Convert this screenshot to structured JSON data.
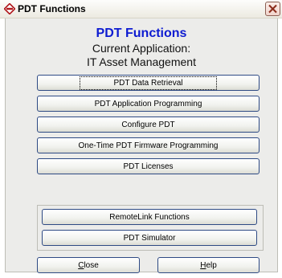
{
  "window": {
    "title": "PDT Functions"
  },
  "header": {
    "title": "PDT Functions",
    "subtitle_line1": "Current Application:",
    "subtitle_line2": "IT Asset Management"
  },
  "buttons": {
    "data_retrieval": "PDT Data Retrieval",
    "app_programming": "PDT Application Programming",
    "configure": "Configure PDT",
    "firmware": "One-Time PDT Firmware Programming",
    "licenses": "PDT Licenses",
    "remotelink": "RemoteLink Functions",
    "simulator": "PDT Simulator"
  },
  "footer": {
    "close_first": "C",
    "close_rest": "lose",
    "help_first": "H",
    "help_rest": "elp"
  },
  "colors": {
    "heading_blue": "#0d1bd1",
    "button_border": "#2e4a84",
    "panel_bg": "#ececea"
  }
}
